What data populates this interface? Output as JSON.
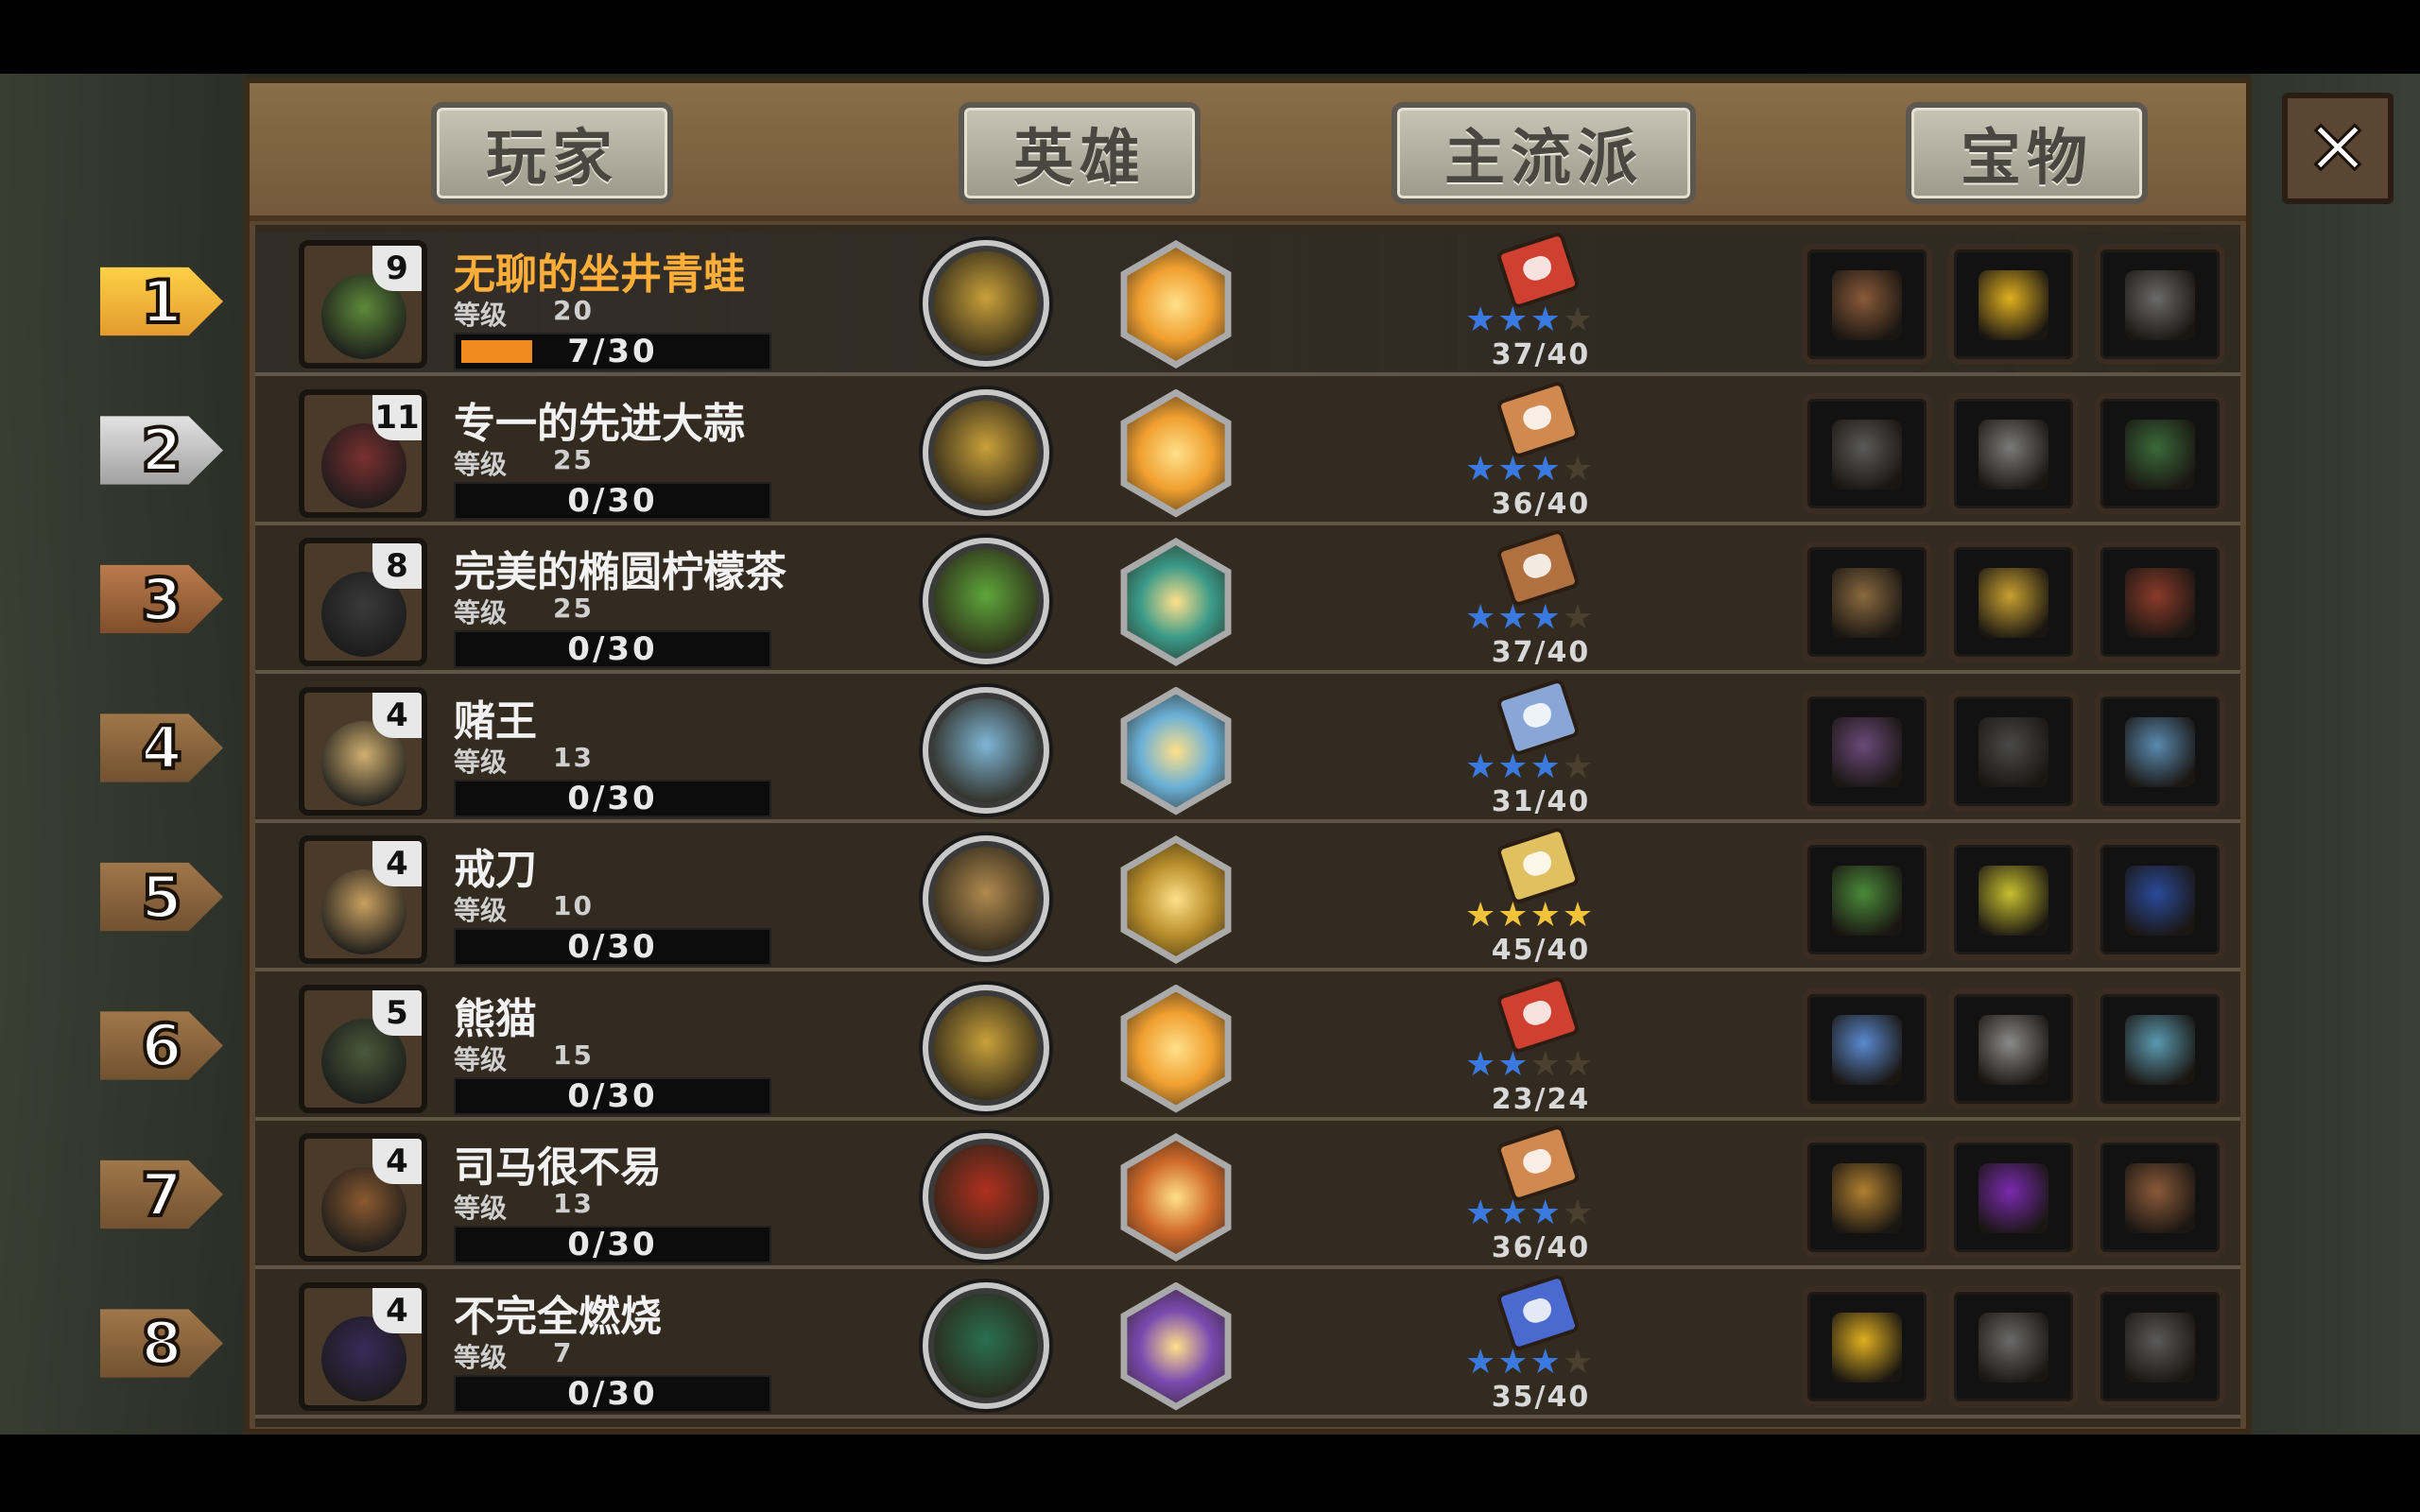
{
  "tabs": [
    "玩家",
    "英雄",
    "主流派",
    "宝物"
  ],
  "close_label": "✕",
  "level_label": "等级",
  "colors": {
    "xp_fill": "#f08a1e",
    "first_name": "#ffae3a",
    "star_blue": "#3a7ae0",
    "star_gold": "#f1c33a"
  },
  "players": [
    {
      "rank": "1",
      "badge": "9",
      "name": "无聊的坐井青蛙",
      "level": "20",
      "xp_text": "7/30",
      "xp_progress": 0.233,
      "stars_on": 3,
      "stars_total": 4,
      "star_color": "blue",
      "score": "37/40",
      "circle_icon": "gold-coins-icon",
      "hex_icon": "coin-star-icon",
      "book_icon": "red-book-icon",
      "treasures": [
        "meat-crate-icon",
        "gear-icon",
        "horned-helmet-icon"
      ]
    },
    {
      "rank": "2",
      "badge": "11",
      "name": "专一的先进大蒜",
      "level": "25",
      "xp_text": "0/30",
      "xp_progress": 0,
      "stars_on": 3,
      "stars_total": 4,
      "star_color": "blue",
      "score": "36/40",
      "circle_icon": "gold-coins-icon",
      "hex_icon": "coin-star-icon",
      "book_icon": "heart-book-icon",
      "treasures": [
        "horned-helmet-icon",
        "scales-icon",
        "ink-scroll-icon"
      ]
    },
    {
      "rank": "3",
      "badge": "8",
      "name": "完美的椭圆柠檬茶",
      "level": "25",
      "xp_text": "0/30",
      "xp_progress": 0,
      "stars_on": 3,
      "stars_total": 4,
      "star_color": "blue",
      "score": "37/40",
      "circle_icon": "money-pile-icon",
      "hex_icon": "fish-school-icon",
      "book_icon": "shield-book-icon",
      "treasures": [
        "telescope-icon",
        "meat-crate-icon",
        "horned-helmet-icon"
      ]
    },
    {
      "rank": "4",
      "badge": "4",
      "name": "赌王",
      "level": "13",
      "xp_text": "0/30",
      "xp_progress": 0,
      "stars_on": 3,
      "stars_total": 4,
      "star_color": "blue",
      "score": "31/40",
      "circle_icon": "spirit-swirl-icon",
      "hex_icon": "ice-crystal-icon",
      "book_icon": "wing-book-icon",
      "treasures": [
        "ring-icon",
        "gold-ingot-icon",
        "armor-icon"
      ]
    },
    {
      "rank": "5",
      "badge": "4",
      "name": "戒刀",
      "level": "10",
      "xp_text": "0/30",
      "xp_progress": 0,
      "stars_on": 4,
      "stars_total": 4,
      "star_color": "gold",
      "score": "45/40",
      "circle_icon": "sand-bag-icon",
      "hex_icon": "treasure-sack-icon",
      "book_icon": "golden-book-icon",
      "treasures": [
        "spellbook-icon",
        "spear-icon",
        "magic-staff-icon"
      ]
    },
    {
      "rank": "6",
      "badge": "5",
      "name": "熊猫",
      "level": "15",
      "xp_text": "0/30",
      "xp_progress": 0,
      "stars_on": 2,
      "stars_total": 4,
      "star_color": "blue",
      "score": "23/24",
      "circle_icon": "gold-coins-icon",
      "hex_icon": "coin-star-icon",
      "book_icon": "red-book-icon",
      "treasures": [
        "cash-stack-icon",
        "clover-icon",
        "sapphire-icon"
      ]
    },
    {
      "rank": "7",
      "badge": "4",
      "name": "司马很不易",
      "level": "13",
      "xp_text": "0/30",
      "xp_progress": 0,
      "stars_on": 3,
      "stars_total": 4,
      "star_color": "blue",
      "score": "36/40",
      "circle_icon": "blood-drop-icon",
      "hex_icon": "fire-burst-icon",
      "book_icon": "heart-book-icon",
      "treasures": [
        "compass-icon",
        "generator-icon",
        "anchor-icon"
      ]
    },
    {
      "rank": "8",
      "badge": "4",
      "name": "不完全燃烧",
      "level": "7",
      "xp_text": "0/30",
      "xp_progress": 0,
      "stars_on": 3,
      "stars_total": 4,
      "star_color": "blue",
      "score": "35/40",
      "circle_icon": "green-boot-icon",
      "hex_icon": "kunai-icon",
      "book_icon": "blue-book-icon",
      "treasures": [
        "goblet-icon",
        "scales-icon",
        "purple-dagger-icon"
      ]
    }
  ]
}
